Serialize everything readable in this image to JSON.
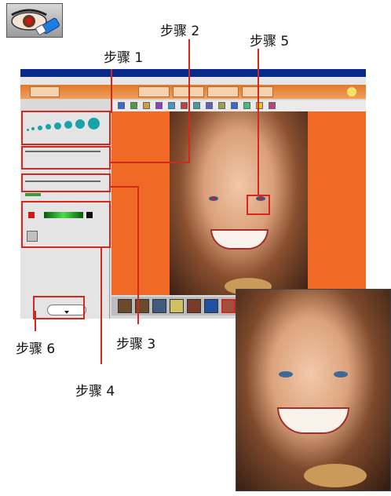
{
  "steps": [
    {
      "label": "步骤 1"
    },
    {
      "label": "步骤 2"
    },
    {
      "label": "步骤 3"
    },
    {
      "label": "步骤 4"
    },
    {
      "label": "步骤 5"
    },
    {
      "label": "步骤 6"
    }
  ],
  "colors": {
    "accent_red": "#d4281e",
    "tab_orange": "#e07a2a",
    "photo_background": "#f06a26",
    "panel_gray": "#e4e4e4",
    "title_blue": "#0a2a8a"
  },
  "icons": {
    "tool_icon": "red-eye-tool-icon",
    "ok_button_icon": "ok-arrow-icon"
  }
}
